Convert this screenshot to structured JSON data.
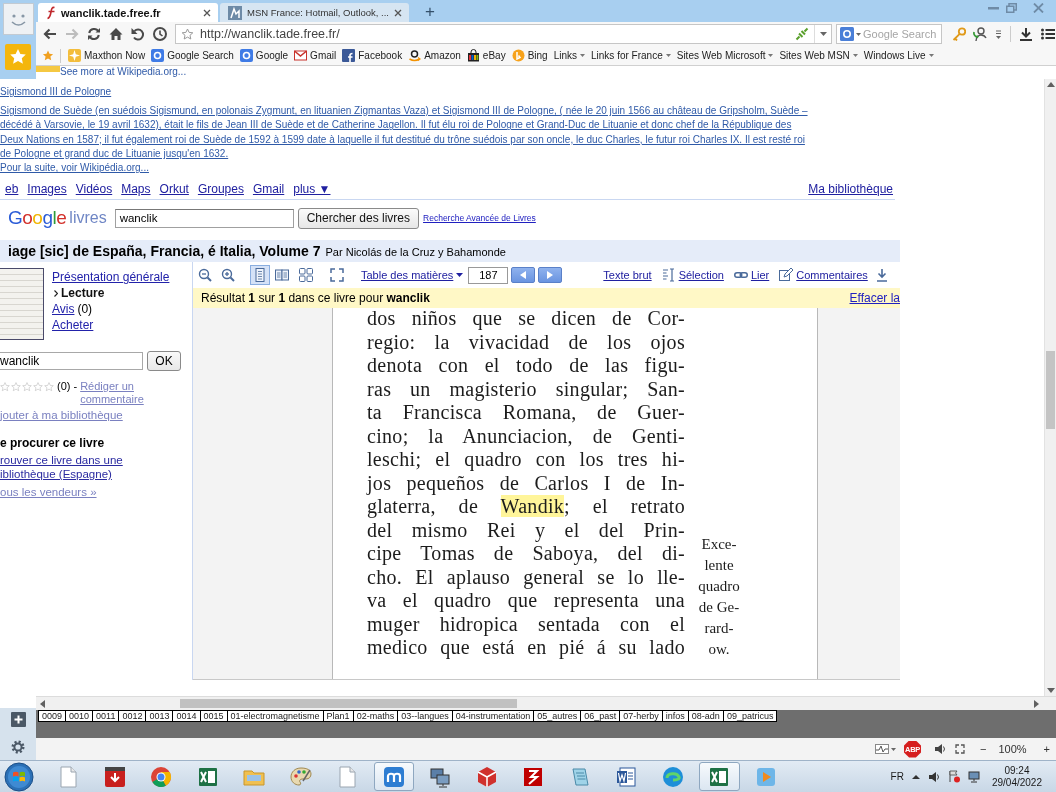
{
  "browser": {
    "tabs": [
      {
        "title": "wanclik.tade.free.fr",
        "selected": true
      },
      {
        "title": "MSN France: Hotmail, Outlook, ...",
        "selected": false
      }
    ],
    "new_tab": "+",
    "nav": {
      "forward_disabled": true
    },
    "address": {
      "url": "http://wanclik.tade.free.fr/"
    },
    "search": {
      "placeholder": "Google Search"
    },
    "bookmarks": [
      {
        "label": "Maxthon Now",
        "kind": "link"
      },
      {
        "label": "Google Search",
        "kind": "link"
      },
      {
        "label": "Google",
        "kind": "link"
      },
      {
        "label": "Gmail",
        "kind": "link"
      },
      {
        "label": "Facebook",
        "kind": "link"
      },
      {
        "label": "Amazon",
        "kind": "link"
      },
      {
        "label": "eBay",
        "kind": "link"
      },
      {
        "label": "Bing",
        "kind": "link"
      },
      {
        "label": "Links",
        "kind": "folder"
      },
      {
        "label": "Links for France",
        "kind": "folder"
      },
      {
        "label": "Sites Web Microsoft",
        "kind": "folder"
      },
      {
        "label": "Sites Web MSN",
        "kind": "folder"
      },
      {
        "label": "Windows Live",
        "kind": "folder"
      }
    ]
  },
  "page": {
    "cut_text": "See more at Wikipedia.org...",
    "wiki": {
      "title": "Sigismond III de Pologne",
      "summary": "Sigismond de Suède (en suédois Sigismund, en polonais Zygmunt, en lituanien Zigmantas Vaza) et Sigismond III de Pologne, ( née le 20 juin 1566 au château de Gripsholm, Suède – décédé à Varsovie, le 19 avril 1632), était le fils de Jean III de Suède et de Catherine Jagellon. Il fut élu roi de Pologne et Grand-Duc de Lituanie et donc chef de la République des Deux Nations en 1587; il fut également roi de Suède de 1592 à 1599 date à laquelle il fut destitué du trône suédois par son oncle, le duc Charles, le futur roi Charles IX. Il est resté roi de Pologne et grand duc de Lituanie jusqu'en 1632.",
      "more": "Pour la suite, voir Wikipédia.org..."
    },
    "google_nav": {
      "items": [
        "eb",
        "Images",
        "Vidéos",
        "Maps",
        "Orkut",
        "Groupes",
        "Gmail",
        "plus ▼"
      ],
      "library": "Ma bibliothèque"
    },
    "books_search": {
      "logo": "Google",
      "product": "livres",
      "value": "wanclik",
      "button": "Chercher des livres",
      "advanced": "Recherche Avancée de Livres"
    },
    "book": {
      "title": "iage [sic] de España, Francia, é Italia, Volume 7",
      "author": "Par Nicolás de la Cruz y Bahamonde"
    },
    "sidebar": {
      "nav": [
        {
          "label": "Présentation générale",
          "selected": false
        },
        {
          "label": "Lecture",
          "selected": true
        },
        {
          "label": "Avis",
          "count": "(0)",
          "selected": false
        },
        {
          "label": "Acheter",
          "selected": false
        }
      ],
      "search": {
        "value": "wanclik",
        "button": "OK"
      },
      "rating": {
        "stars": 0,
        "count": "(0) -",
        "review": "Rédiger un commentaire"
      },
      "add_link": "jouter à ma bibliothèque",
      "get_heading": "e procurer ce livre",
      "library_link": "rouver ce livre dans une ibliothèque (Espagne)",
      "sellers_link": "ous les vendeurs »"
    },
    "viewer": {
      "views": [
        {
          "selected": true
        },
        {
          "selected": false
        },
        {
          "selected": false
        }
      ],
      "toc": "Table des matières",
      "page": "187",
      "tools": [
        "Texte brut",
        "Sélection",
        "Lier",
        "Commentaires"
      ],
      "result": "Résultat **1** sur **1** dans ce livre pour **wanclik**",
      "clear": "Effacer la",
      "lines": [
        {
          "text": "dos niños que se dicen de Cor-"
        },
        {
          "text": "regio: la vivacidad de los ojos"
        },
        {
          "text": "denota con el todo de las figu-"
        },
        {
          "text": "ras un magisterio singular; San-"
        },
        {
          "text": "ta Francisca Romana, de Guer-"
        },
        {
          "text": "cino; la Anunciacion, de Genti-"
        },
        {
          "text": "leschi; el quadro con los tres hi-"
        },
        {
          "text": "jos pequeños de Carlos I de In-"
        },
        {
          "text": "glaterra, de",
          "highlight": "Wandik",
          "after": "; el retrato"
        },
        {
          "text": "del mismo Rei y el del Prin-"
        },
        {
          "text": "cipe Tomas de Saboya, del di-"
        },
        {
          "text": "cho. El aplauso general se lo lle-"
        },
        {
          "text": "va el quadro que representa una"
        },
        {
          "text": "muger hidropica sentada con el"
        },
        {
          "text": "medico que está en pié á su lado"
        }
      ],
      "margin_note": [
        "Exce-",
        "lente",
        "quadro",
        "de Ge-",
        "rard-",
        "ow."
      ]
    }
  },
  "sheet_tabs": [
    "0009",
    "0010",
    "0011",
    "0012",
    "0013",
    "0014",
    "0015",
    "01-electromagnetisme",
    "Plan1",
    "02-maths",
    "03--langues",
    "04-instrumentation",
    "05_autres",
    "06_past",
    "07-herby",
    "infos",
    "08-adn",
    "09_patricus"
  ],
  "status_bar": {
    "adblock": "ABP",
    "zoom_out": "−",
    "zoom": "100%",
    "zoom_in": "+"
  },
  "taskbar": {
    "apps": [
      {
        "active": false
      },
      {
        "active": false
      },
      {
        "active": false
      },
      {
        "active": false
      },
      {
        "active": false
      },
      {
        "active": false
      },
      {
        "active": false
      },
      {
        "active": true
      },
      {
        "active": false
      },
      {
        "active": false
      },
      {
        "active": false
      },
      {
        "active": false
      },
      {
        "active": false
      },
      {
        "active": false
      },
      {
        "active": true
      },
      {
        "active": false
      }
    ],
    "language": "FR",
    "time": "09:24",
    "date": "29/04/2022"
  }
}
